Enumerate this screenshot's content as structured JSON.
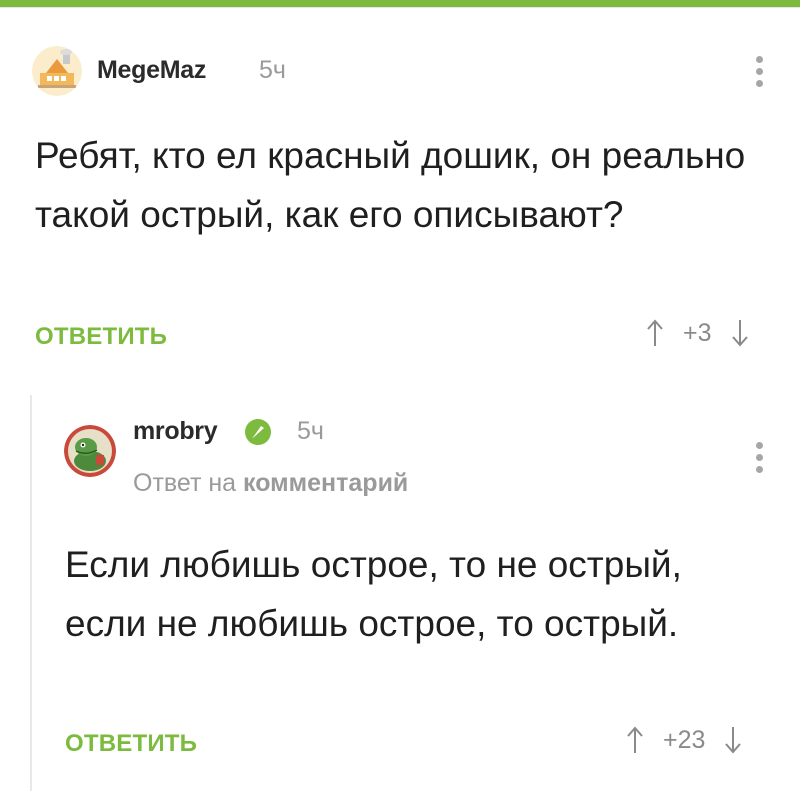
{
  "comments": [
    {
      "author": "MegeMaz",
      "time": "5ч",
      "text": "Ребят, кто ел красный дошик, он реально такой острый, как его описывают?",
      "reply_label": "ОТВЕТИТЬ",
      "rating": "+3",
      "avatar_icon": "house-avatar-icon"
    },
    {
      "author": "mrobry",
      "time": "5ч",
      "verified": true,
      "reply_to_prefix": "Ответ на",
      "reply_to_link": "комментарий",
      "text": "Если любишь острое, то не острый, если не любишь острое, то острый.",
      "reply_label": "ОТВЕТИТЬ",
      "rating": "+23",
      "avatar_icon": "dinosaur-avatar-icon"
    }
  ],
  "colors": {
    "accent": "#7dbb3f",
    "text": "#1f1f1f",
    "muted": "#9a9a9a"
  }
}
